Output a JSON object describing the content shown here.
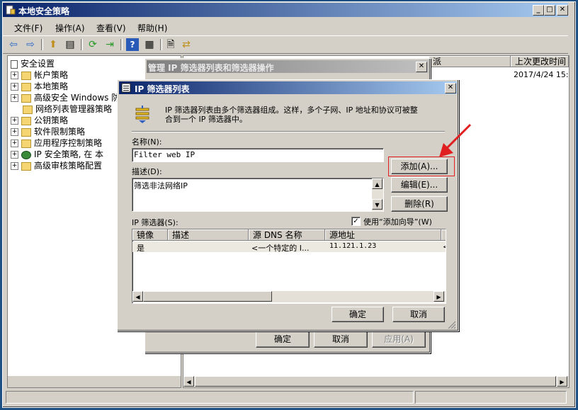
{
  "main_window": {
    "title": "本地安全策略",
    "menu": [
      "文件(F)",
      "操作(A)",
      "查看(V)",
      "帮助(H)"
    ]
  },
  "tree": {
    "root": "安全设置",
    "items": [
      {
        "label": "帐户策略",
        "expander": "+"
      },
      {
        "label": "本地策略",
        "expander": "+"
      },
      {
        "label": "高级安全 Windows 防",
        "expander": "+"
      },
      {
        "label": "网络列表管理器策略",
        "expander": ""
      },
      {
        "label": "公钥策略",
        "expander": "+"
      },
      {
        "label": "软件限制策略",
        "expander": "+"
      },
      {
        "label": "应用程序控制策略",
        "expander": "+"
      },
      {
        "label": "IP 安全策略, 在 本",
        "expander": "+"
      },
      {
        "label": "高级审核策略配置",
        "expander": "+"
      }
    ]
  },
  "right_panel": {
    "columns": [
      "派",
      "上次更改时间"
    ],
    "row_date": "2017/4/24 15:"
  },
  "manage_dialog": {
    "title": "管理 IP 筛选器列表和筛选器操作",
    "ok": "确定",
    "cancel": "取消",
    "apply": "应用(A)"
  },
  "filter_dialog": {
    "title": "IP 筛选器列表",
    "description_line1": "IP 筛选器列表由多个筛选器组成。这样，多个子网、IP 地址和协议可被整",
    "description_line2": "合到一个 IP 筛选器中。",
    "name_label": "名称(N):",
    "name_value": "Filter web IP",
    "desc_label": "描述(D):",
    "desc_value": "筛选非法网络IP",
    "add_button": "添加(A)...",
    "edit_button": "编辑(E)...",
    "delete_button": "删除(R)",
    "filters_label": "IP 筛选器(S):",
    "use_wizard_label": "使用“添加向导”(W)",
    "use_wizard_checked": true,
    "columns": [
      "镜像",
      "描述",
      "源 DNS 名称",
      "源地址",
      "目"
    ],
    "rows": [
      {
        "mirror": "是",
        "desc": "",
        "src_dns": "<一个特定的 I...",
        "src_addr": "11.121.1.23",
        "dst": "<"
      }
    ],
    "ok": "确定",
    "cancel": "取消"
  },
  "colors": {
    "title_active": "#0a246a",
    "title_gradient_end": "#a6caf0",
    "annotation_red": "#e02020",
    "desktop": "#1e4f82"
  }
}
